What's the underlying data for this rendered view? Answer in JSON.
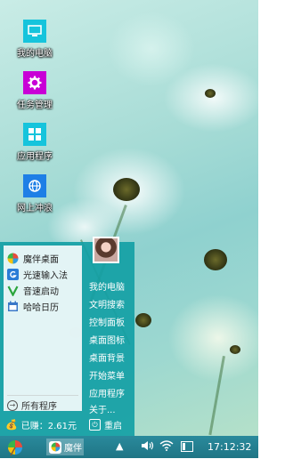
{
  "desktop": {
    "icons": [
      {
        "label": "我的电脑",
        "icon": "monitor-icon",
        "color": "#16c4dc"
      },
      {
        "label": "任务管理",
        "icon": "gear-icon",
        "color": "#c800d6"
      },
      {
        "label": "应用程序",
        "icon": "grid-icon",
        "color": "#16c4dc"
      },
      {
        "label": "网上冲浪",
        "icon": "globe-icon",
        "color": "#1e7fe6"
      }
    ]
  },
  "start_menu": {
    "programs": [
      {
        "label": "魔伴桌面",
        "icon": "pinwheel-icon"
      },
      {
        "label": "光速输入法",
        "icon": "keyboard-g-icon"
      },
      {
        "label": "音速启动",
        "icon": "v-launcher-icon"
      },
      {
        "label": "哈哈日历",
        "icon": "calendar-icon"
      }
    ],
    "all_programs_label": "所有程序",
    "system_items": [
      "我的电脑",
      "文明搜索",
      "控制面板",
      "桌面图标",
      "桌面背景",
      "开始菜单",
      "应用程序",
      "关于..."
    ],
    "earnings_label": "已赚：2.61元",
    "restart_label": "重启",
    "accent_color": "#14a0a5"
  },
  "taskbar": {
    "app_label": "魔伴",
    "clock": "17:12:32",
    "battery_level": 0.3,
    "color": "#1f7585"
  }
}
